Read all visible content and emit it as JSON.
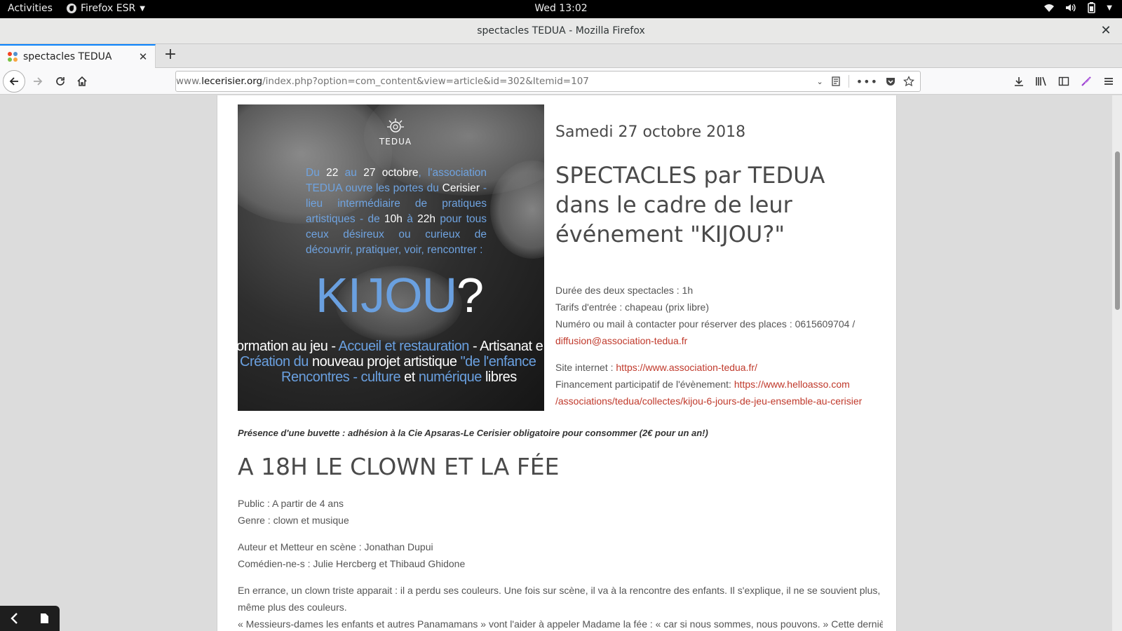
{
  "system": {
    "activities": "Activities",
    "app_name": "Firefox ESR",
    "clock": "Wed 13:02"
  },
  "window": {
    "title": "spectacles TEDUA - Mozilla Firefox",
    "close_glyph": "✕"
  },
  "tabs": [
    {
      "title": "spectacles TEDUA",
      "close_glyph": "✕"
    }
  ],
  "new_tab_glyph": "+",
  "urlbar": {
    "prefix": "www.",
    "domain": "lecerisier.org",
    "path": "/index.php?option=com_content&view=article&id=302&Itemid=107"
  },
  "page": {
    "poster": {
      "logo_text": "TEDUA",
      "blurb_parts": [
        "Du ",
        "22",
        " au ",
        "27 octobre",
        ", l'association TEDUA ouvre les portes du ",
        "Cerisier",
        " - lieu intermédiaire de pratiques artistiques - de ",
        "10h",
        " à ",
        "22h",
        " pour tous ceux désireux ou curieux de découvrir, pratiquer, voir, rencontrer :"
      ],
      "kijou": "KIJOU",
      "kijou_q": "?",
      "line1_a": "ormation au jeu - ",
      "line1_b": "Accueil et restauration",
      "line1_c": " - Artisanat e",
      "line2_a": "Création du",
      "line2_b": " nouveau projet artistique ",
      "line2_c": "\"de l'enfance",
      "line3_a": "Rencontres - culture",
      "line3_b": " et ",
      "line3_c": "numérique",
      "line3_d": " libres"
    },
    "date": "Samedi 27 octobre 2018",
    "headline": "SPECTACLES par TEDUA dans le cadre de leur événement \"KIJOU?\"",
    "info": {
      "duree": "Durée des deux spectacles : 1h",
      "tarifs": "Tarifs d'entrée : chapeau (prix libre)",
      "contact": "Numéro ou mail à contacter pour réserver des places : 0615609704 /",
      "email": "diffusion@association-tedua.fr",
      "site_label": "Site internet : ",
      "site_url": "https://www.association-tedua.fr/",
      "financement_label": "Financement participatif de l'évènement: ",
      "financement_url_1": "https://www.helloasso.com",
      "financement_url_2": "/associations/tedua/collectes/kijou-6-jours-de-jeu-ensemble-au-cerisier"
    },
    "buvette": "Présence d'une buvette : adhésion à la Cie Apsaras-Le Cerisier obligatoire pour consommer (2€ pour un an!)",
    "section_title": "A 18H LE CLOWN ET LA FÉE",
    "public": "Public : A partir de 4 ans",
    "genre": "Genre : clown et musique",
    "auteur": "Auteur et Metteur en scène : Jonathan Dupui",
    "comediens": "Comédien-ne-s : Julie Hercberg et Thibaud Ghidone",
    "synopsis_1": "En errance, un clown triste apparait : il a perdu ses couleurs. Une fois sur scène, il va à la rencontre des enfants. Il s'explique, il ne se souvient plus,",
    "synopsis_2": "même plus des couleurs.",
    "synopsis_3": "« Messieurs-dames les enfants et autres Panamamans » vont l'aider à appeler Madame la fée : « car si nous sommes, nous pouvons. » Cette dernière"
  }
}
